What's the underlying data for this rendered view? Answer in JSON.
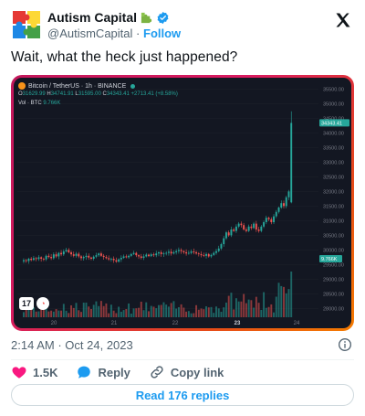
{
  "author": {
    "display_name": "Autism Capital",
    "handle": "@AutismCapital",
    "separator": "·",
    "follow_label": "Follow"
  },
  "tweet": {
    "text": "Wait, what the heck just happened?"
  },
  "chart": {
    "title": "Bitcoin / TetherUS · 1h · BINANCE",
    "ohlc": {
      "o_label": "O",
      "o": "31629.99",
      "h_label": "H",
      "h": "34741.91",
      "l_label": "L",
      "l": "31595.00",
      "c_label": "C",
      "c": "34343.41",
      "change": "+2713.41 (+8.58%)"
    },
    "volume_label": "Vol · BTC",
    "volume_value": "9.766K",
    "price_labels": [
      "35500.00",
      "35000.00",
      "34500.00",
      "34000.00",
      "33500.00",
      "33000.00",
      "32500.00",
      "32000.00",
      "31500.00",
      "31000.00",
      "30500.00",
      "30000.00",
      "29500.00",
      "29000.00",
      "28500.00",
      "28000.00"
    ],
    "date_labels": [
      "20",
      "21",
      "22",
      "23",
      "24"
    ],
    "last_price_tag": "34343.41",
    "volume_tag": "9.766K",
    "tv_logo_text": "17",
    "accent_up": "#26a69a",
    "accent_down": "#ef5350"
  },
  "chart_data": {
    "type": "candlestick",
    "series": [
      {
        "name": "BTCUSDT",
        "values": [
          29650,
          29620,
          29700,
          29660,
          29720,
          29690,
          29750,
          29700,
          29680,
          29800,
          29760,
          29720,
          29850,
          29780,
          29900,
          29850,
          29950,
          30000,
          29920,
          29850,
          29800,
          29870,
          29780,
          29720,
          29760,
          29800,
          29740,
          29700,
          29770,
          29820,
          29880,
          29800,
          29760,
          29720,
          29680,
          29700,
          29650,
          29600,
          29680,
          29730,
          29780,
          29750,
          29800,
          29860,
          29900,
          29820,
          29780,
          29730,
          29780,
          29840,
          29790,
          29850,
          29820,
          29880,
          29920,
          29860,
          29880,
          29900,
          29940,
          29880,
          29920,
          29960,
          30000,
          29960,
          29920,
          29880,
          29900,
          29950,
          29920,
          29880,
          29860,
          29820,
          29800,
          29860,
          29780,
          29830,
          29900,
          29960,
          30050,
          30200,
          30400,
          30600,
          30500,
          30700,
          30650,
          30800,
          30900,
          30850,
          30700,
          30650,
          30800,
          30750,
          30900,
          30700,
          30650,
          30800,
          30950,
          31100,
          31050,
          30950,
          31150,
          31300,
          31450,
          31600,
          31500,
          31800,
          32000,
          34343
        ]
      },
      {
        "name": "Volume",
        "values": []
      }
    ],
    "xlabel": "",
    "ylabel": "",
    "ylim": [
      27700,
      35700
    ],
    "x_ticks": [
      "20",
      "21",
      "22",
      "23",
      "24"
    ]
  },
  "meta": {
    "time": "2:14 AM",
    "separator": "·",
    "date": "Oct 24, 2023"
  },
  "actions": {
    "like_count": "1.5K",
    "reply_label": "Reply",
    "copy_link_label": "Copy link"
  },
  "footer": {
    "read_replies_label": "Read 176 replies"
  },
  "colors": {
    "link_blue": "#1d9bf0",
    "like_red": "#f91880",
    "muted": "#536471",
    "chart_bg": "#131722"
  }
}
